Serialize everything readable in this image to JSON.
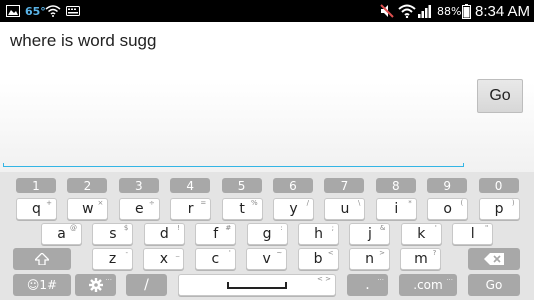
{
  "status_bar": {
    "temperature": "65°",
    "battery_percent": "88%",
    "time": "8:34 AM",
    "icons": [
      "image-icon",
      "wifi-icon",
      "keyboard-icon",
      "mute-icon",
      "wifi-icon",
      "signal-icon",
      "battery-icon"
    ]
  },
  "app": {
    "query_text": "where is word sugg",
    "go_label": "Go"
  },
  "keyboard": {
    "number_row": [
      "1",
      "2",
      "3",
      "4",
      "5",
      "6",
      "7",
      "8",
      "9",
      "0"
    ],
    "row1": [
      {
        "key": "q",
        "alt": "+"
      },
      {
        "key": "w",
        "alt": "×"
      },
      {
        "key": "e",
        "alt": "÷"
      },
      {
        "key": "r",
        "alt": "="
      },
      {
        "key": "t",
        "alt": "%"
      },
      {
        "key": "y",
        "alt": "/"
      },
      {
        "key": "u",
        "alt": "\\"
      },
      {
        "key": "i",
        "alt": "*"
      },
      {
        "key": "o",
        "alt": "("
      },
      {
        "key": "p",
        "alt": ")"
      }
    ],
    "row2": [
      {
        "key": "a",
        "alt": "@"
      },
      {
        "key": "s",
        "alt": "$"
      },
      {
        "key": "d",
        "alt": "!"
      },
      {
        "key": "f",
        "alt": "#"
      },
      {
        "key": "g",
        "alt": ":"
      },
      {
        "key": "h",
        "alt": ";"
      },
      {
        "key": "j",
        "alt": "&"
      },
      {
        "key": "k",
        "alt": "'"
      },
      {
        "key": "l",
        "alt": "\""
      }
    ],
    "row3": [
      {
        "key": "z",
        "alt": "-"
      },
      {
        "key": "x",
        "alt": "_"
      },
      {
        "key": "c",
        "alt": "'"
      },
      {
        "key": "v",
        "alt": "~"
      },
      {
        "key": "b",
        "alt": "<"
      },
      {
        "key": "n",
        "alt": ">"
      },
      {
        "key": "m",
        "alt": "?"
      }
    ],
    "mode_label": "☺1#",
    "slash_label": "/",
    "dotcom_label": ".com",
    "go_label": "Go",
    "period_label": ".",
    "settings_alt": "...",
    "space_alt": "<  >",
    "period_alt": "...",
    "dotcom_alt": "..."
  },
  "colors": {
    "accent": "#33b5e5",
    "temperature": "#5ab4e8",
    "func_key": "#a8a8a8",
    "keyboard_bg": "#e4e4e4"
  }
}
